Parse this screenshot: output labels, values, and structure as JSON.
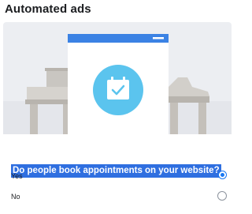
{
  "header": {
    "title": "Automated ads"
  },
  "question": {
    "text": "Do people book appointments on your website?",
    "options": [
      {
        "label": "Yes",
        "selected": true
      },
      {
        "label": "No",
        "selected": false
      }
    ]
  },
  "colors": {
    "accent": "#1877f2",
    "selection_highlight": "#2f6fe0",
    "scene_background": "#eceef2",
    "calendar_circle": "#5bc4ee"
  },
  "icons": {
    "illustration": "calendar-check-icon",
    "selected_radio": "radio-checked-icon",
    "unselected_radio": "radio-unchecked-icon"
  }
}
